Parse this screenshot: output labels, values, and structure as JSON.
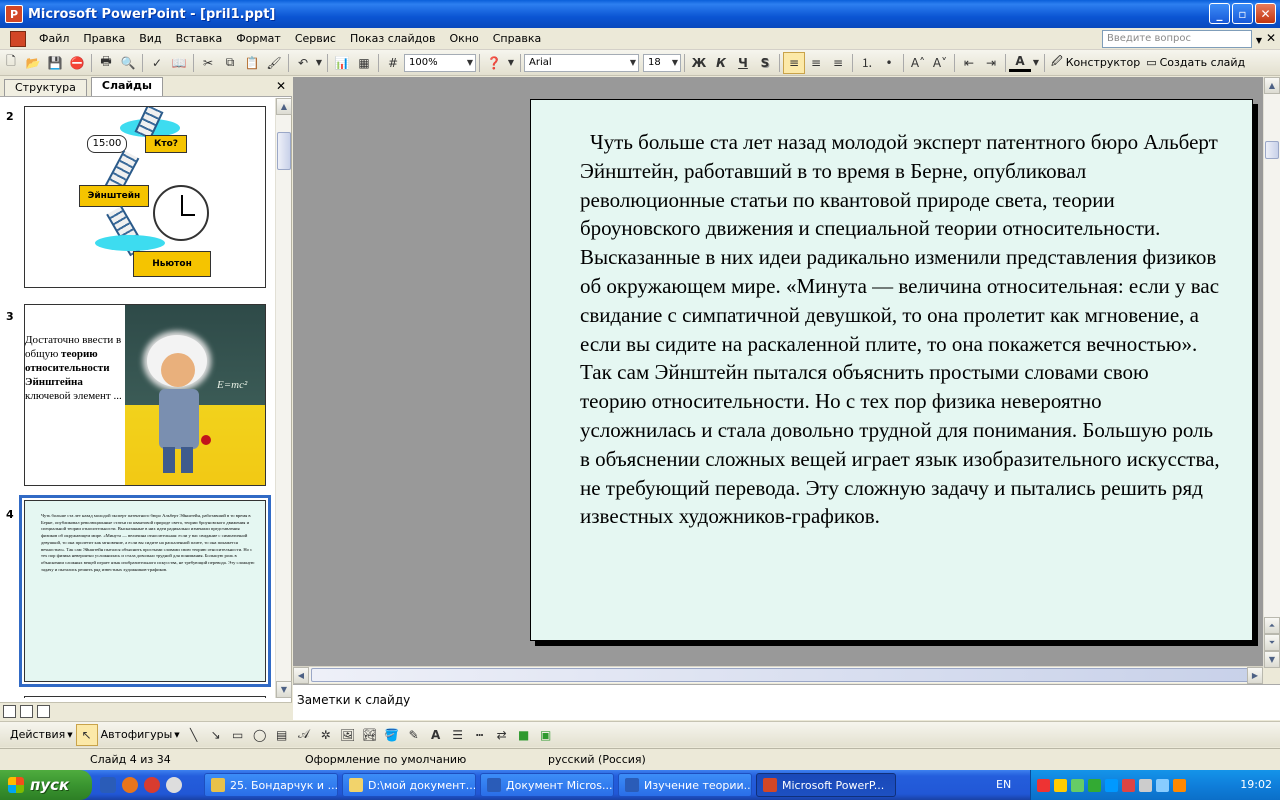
{
  "window": {
    "title": "Microsoft PowerPoint - [pril1.ppt]",
    "app_letter": "P"
  },
  "menu": {
    "items": [
      "Файл",
      "Правка",
      "Вид",
      "Вставка",
      "Формат",
      "Сервис",
      "Показ слайдов",
      "Окно",
      "Справка"
    ],
    "ask_placeholder": "Введите вопрос"
  },
  "toolbar": {
    "zoom": "100%",
    "font": "Arial",
    "font_size": "18",
    "bold": "Ж",
    "italic": "К",
    "underline": "Ч",
    "shadow": "S",
    "designer": "Конструктор",
    "new_slide": "Создать слайд"
  },
  "left_panel": {
    "tabs": [
      "Структура",
      "Слайды"
    ],
    "active_tab": "Слайды",
    "slides": [
      {
        "number": "2",
        "digital_clock": "15:00",
        "labels": [
          "Кто?",
          "Эйнштейн",
          "Ньютон"
        ]
      },
      {
        "number": "3",
        "text_before": "Достаточно ввести в общую ",
        "text_bold": "теорию относительности Эйнштейна",
        "text_after": " ключевой элемент ...",
        "formula": "E=mc²"
      },
      {
        "number": "4",
        "text": "Чуть больше ста лет назад молодой эксперт патентного бюро Альберт Эйнштейн, работавший в то время в Берне, опубликовал революционные статьи по квантовой природе света, теории броуновского движения и специальной теории относительности. Высказанные в них идеи радикально изменили представления физиков об окружающем мире. «Минута — величина относительная: если у вас свидание с симпатичной девушкой, то она пролетит как мгновение, а если вы сидите на раскаленной плите, то она покажется вечностью». Так сам Эйнштейн пытался объяснить простыми словами свою теорию относительности. Но с тех пор физика невероятно усложнилась и стала довольно трудной для понимания. Большую роль в объяснении сложных вещей играет язык изобразительного искусства, не требующий перевода. Эту сложную задачу и пытались решить ряд известных художников-графиков."
      }
    ]
  },
  "slide": {
    "text": "Чуть больше ста лет назад молодой эксперт патентного бюро Альберт Эйнштейн, работавший в то время в Берне, опубликовал революционные статьи по квантовой природе света, теории броуновского движения и специальной теории относительности. Высказанные в них идеи радикально изменили представления физиков об окружающем мире. «Минута — величина относительная: если у вас свидание с симпатичной девушкой, то она пролетит как мгновение, а если вы сидите на раскаленной плите, то она покажется вечностью». Так сам Эйнштейн пытался объяснить простыми словами свою теорию относительности. Но с тех пор физика невероятно усложнилась и стала довольно трудной для понимания. Большую роль в объяснении сложных вещей играет язык изобразительного искусства, не требующий перевода. Эту сложную задачу и пытались решить ряд известных художников-графиков."
  },
  "notes": {
    "placeholder": "Заметки к слайду"
  },
  "drawing": {
    "actions": "Действия",
    "autoshapes": "Автофигуры"
  },
  "status": {
    "slide_pos": "Слайд 4 из 34",
    "design": "Оформление по умолчанию",
    "language": "русский (Россия)"
  },
  "taskbar": {
    "start": "пуск",
    "tasks": [
      "25. Бондарчук и ...",
      "D:\\мой документ...",
      "Документ Micros...",
      "Изучение теории...",
      "Microsoft PowerP..."
    ],
    "lang": "EN",
    "time": "19:02"
  },
  "colors": {
    "titlebar": "#0b55d3",
    "slide_bg": "#e5f7f2",
    "workspace": "#999999",
    "taskbar": "#245edc",
    "start": "#3a9530"
  }
}
